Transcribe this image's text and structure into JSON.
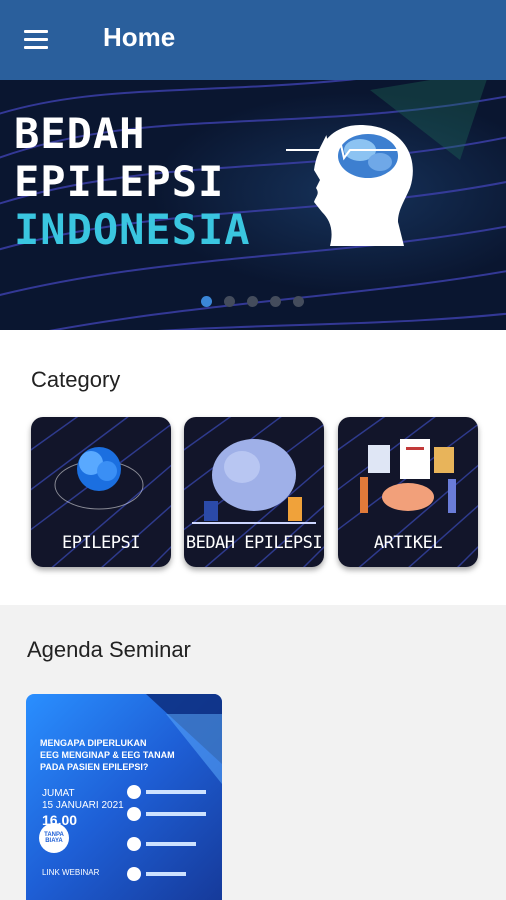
{
  "appbar": {
    "title": "Home"
  },
  "banner": {
    "line1": "BEDAH",
    "line2": "EPILEPSI",
    "line3": "INDONESIA",
    "dot_count": 5,
    "active_dot": 0
  },
  "category": {
    "title": "Category",
    "items": [
      {
        "label": "EPILEPSI"
      },
      {
        "label": "BEDAH EPILEPSI"
      },
      {
        "label": "ARTIKEL"
      }
    ]
  },
  "agenda": {
    "title": "Agenda Seminar",
    "poster": {
      "line1": "MENGAPA DIPERLUKAN",
      "line2": "EEG MENGINAP & EEG TANAM",
      "line3": "PADA PASIEN EPILEPSI?",
      "day": "JUMAT",
      "date": "15 JANUARI 2021",
      "time": "16.00",
      "badge": "TANPA BIAYA",
      "footer": "LINK WEBINAR"
    }
  },
  "colors": {
    "appbar": "#2a5f9c",
    "accent": "#3ac6e0",
    "dot_active": "#3b87d8"
  }
}
